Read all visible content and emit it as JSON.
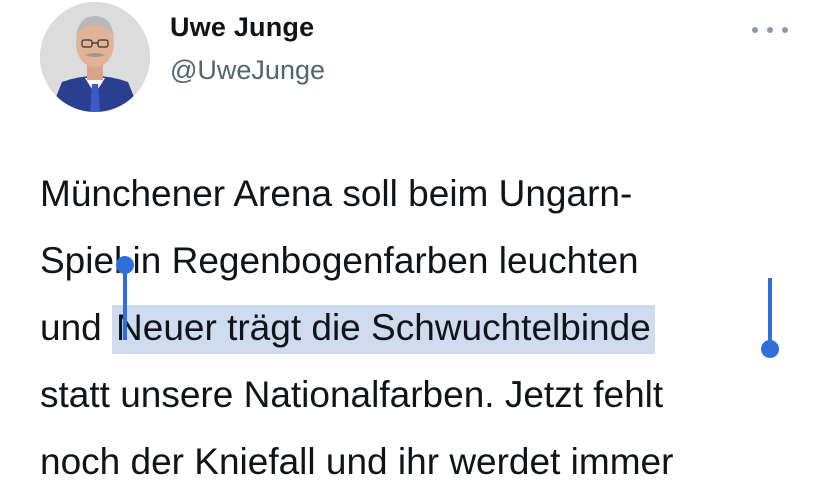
{
  "author": {
    "name": "Uwe Junge",
    "handle": "@UweJunge"
  },
  "icons": {
    "more": "more-horizontal-icon"
  },
  "tweet": {
    "lines": [
      {
        "before": "Münchener Arena soll beim Ungarn-",
        "selected": "",
        "after": ""
      },
      {
        "before": "Spiel in Regenbogenfarben leuchten",
        "selected": "",
        "after": ""
      },
      {
        "before": "und ",
        "selected": "Neuer trägt die Schwuchtelbinde",
        "after": ""
      },
      {
        "before": "statt unsere Nationalfarben. Jetzt fehlt",
        "selected": "",
        "after": ""
      },
      {
        "before": "noch der Kniefall und ihr werdet immer",
        "selected": "",
        "after": ""
      }
    ]
  },
  "colors": {
    "selection_highlight": "#cfdcef",
    "selection_handle": "#2f6fdc",
    "handle_text": "#536471"
  }
}
